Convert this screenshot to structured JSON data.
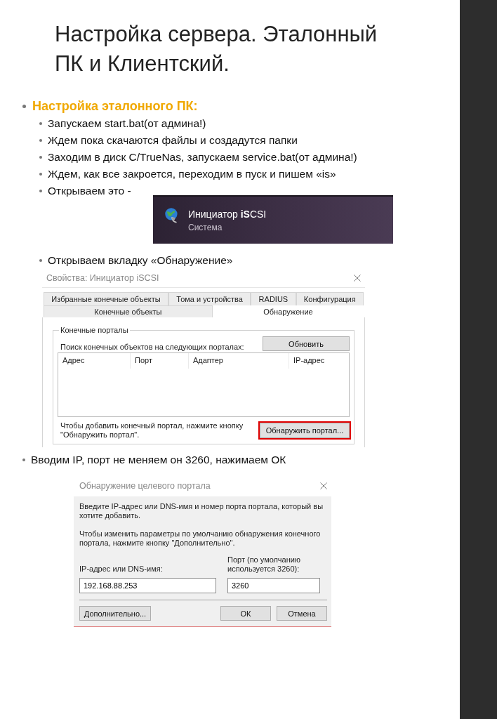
{
  "slide": {
    "title": [
      "Настройка сервера. Эталонный",
      "ПК и Клиентский."
    ],
    "heading": "Настройка эталонного ПК:",
    "steps": [
      "Запускаем start.bat(от админа!)",
      "Ждем пока скачаются файлы и создадутся папки",
      "Заходим в диск C/TrueNas, запускаем service.bat(от админа!)",
      "Ждем, как все закроется, переходим в пуск и пишем «is»",
      "Открываем это -"
    ],
    "search_result": {
      "name": "Инициатор **iS**CSI",
      "category": "Система"
    },
    "step_after": "Открываем вкладку «Обнаружение»",
    "properties_dialog": {
      "title": "Свойства: Инициатор iSCSI",
      "tab_rows": [
        [
          {
            "label": "Избранные конечные объекты",
            "selected": false
          },
          {
            "label": "Тома и устройства",
            "selected": false
          },
          {
            "label": "RADIUS",
            "selected": false
          },
          {
            "label": "Конфигурация",
            "selected": false
          }
        ],
        [
          {
            "label": "Конечные объекты",
            "selected": false
          },
          {
            "label": "Обнаружение",
            "selected": true
          }
        ]
      ],
      "group_title": "Конечные порталы",
      "list_label": "Поиск конечных объектов на следующих порталах:",
      "refresh_button": "Обновить",
      "columns": [
        "Адрес",
        "Порт",
        "Адаптер",
        "IP-адрес"
      ],
      "hint": "Чтобы добавить конечный портал, нажмите кнопку \"Обнаружить портал\".",
      "discover_button": {
        "label": "Обнаружить портал...",
        "highlighted": true
      }
    },
    "note": "Вводим IP, порт не меняем он 3260, нажимаем ОК",
    "portal_dialog": {
      "title": "Обнаружение целевого портала",
      "intro": "Введите IP-адрес или DNS-имя и номер порта портала, который вы хотите добавить.",
      "advanced_hint": "Чтобы изменить параметры по умолчанию обнаружения конечного портала, нажмите кнопку \"Дополнительно\".",
      "ip_label": "IP-адрес или DNS-имя:",
      "ip_value": "192.168.88.253",
      "port_label": "Порт (по умолчанию используется 3260):",
      "port_value": "3260",
      "buttons": [
        "Дополнительно...",
        "ОК",
        "Отмена"
      ]
    }
  }
}
